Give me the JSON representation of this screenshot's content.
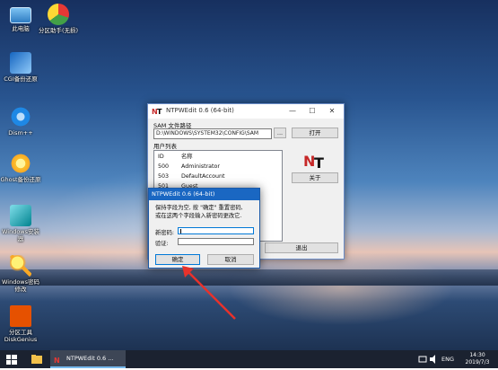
{
  "desktop": {
    "icons": [
      {
        "label": "此电脑",
        "icon": "computer-icon"
      },
      {
        "label": "分区助手(无损)",
        "icon": "partition-assistant-icon"
      },
      {
        "label": "CGI备份还原",
        "icon": "cgi-backup-icon"
      },
      {
        "label": "Dism++",
        "icon": "gear-icon"
      },
      {
        "label": "Ghost备份还原",
        "icon": "ghost-icon"
      },
      {
        "label": "Windows安装器",
        "icon": "windows-installer-icon"
      },
      {
        "label": "Windows密码修改",
        "icon": "key-icon"
      },
      {
        "label": "分区工具DiskGenius",
        "icon": "diskgenius-icon"
      }
    ]
  },
  "main_window": {
    "title": "NTPWEdit 0.6 (64-bit)",
    "sam_label": "SAM 文件路径",
    "sam_path": "D:\\WINDOWS\\SYSTEM32\\CONFIG\\SAM",
    "browse_label": "...",
    "open_label": "打开",
    "user_list_label": "用户列表",
    "columns": [
      "ID",
      "名称"
    ],
    "users": [
      {
        "id": "500",
        "name": "Administrator"
      },
      {
        "id": "503",
        "name": "DefaultAccount"
      },
      {
        "id": "501",
        "name": "Guest"
      }
    ],
    "about_label": "关于",
    "exit_label": "退出",
    "minimize": "—",
    "maximize": "☐",
    "close": "✕"
  },
  "dialog": {
    "title": "NTPWEdit 0.6 (64-bit)",
    "message_line1": "保持字段为空, 按 \"确定\" 重置密码,",
    "message_line2": "或在这两个字段输入新密码更改它.",
    "new_password_label": "新密码:",
    "confirm_label": "验证:",
    "ok_label": "确定",
    "cancel_label": "取消"
  },
  "taskbar": {
    "task_label": "NTPWEdit 0.6 ...",
    "lang": "ENG",
    "time": "14:30",
    "date": "2019/7/3"
  },
  "colors": {
    "accent": "#0078d7",
    "dialog_title": "#1a67c2",
    "arrow": "#e8322b"
  }
}
